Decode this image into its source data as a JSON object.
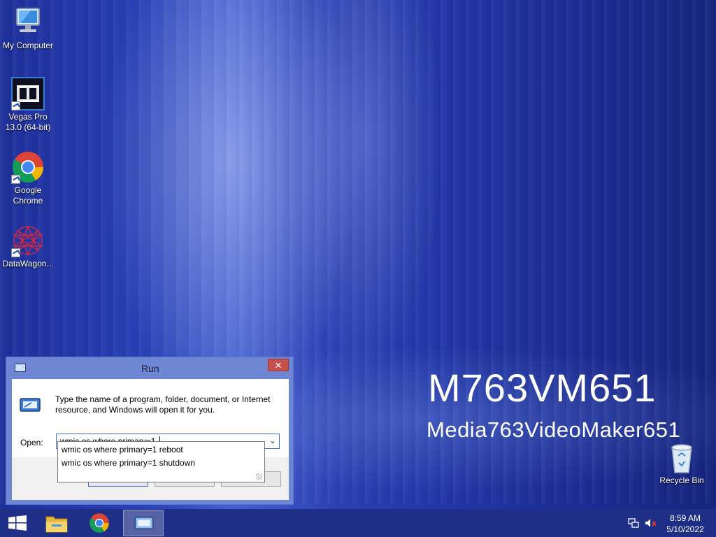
{
  "desktop": {
    "icons": [
      {
        "label": "My Computer"
      },
      {
        "label": "Vegas Pro 13.0 (64-bit)"
      },
      {
        "label": "Google Chrome"
      },
      {
        "label": "DataWagon..."
      }
    ],
    "recycle_bin": {
      "label": "Recycle Bin"
    },
    "branding": {
      "title": "M763VM651",
      "subtitle": "Media763VideoMaker651"
    }
  },
  "run_dialog": {
    "title": "Run",
    "close_symbol": "✕",
    "description": "Type the name of a program, folder, document, or Internet resource, and Windows will open it for you.",
    "open_label": "Open:",
    "input_value": "wmic os where primary=1 ",
    "suggestions": [
      "wmic os where primary=1 reboot",
      "wmic os where primary=1 shutdown"
    ]
  },
  "taskbar": {
    "buttons": [
      "start-icon",
      "file-explorer-icon",
      "chrome-icon",
      "run-icon"
    ],
    "tray_icons": [
      "network-icon",
      "volume-muted-icon"
    ],
    "time": "8:59 AM",
    "date": "5/10/2022"
  },
  "colors": {
    "taskbar": "#1f2e86",
    "dialog_frame": "#6e86d4",
    "close_button": "#c7514a"
  }
}
